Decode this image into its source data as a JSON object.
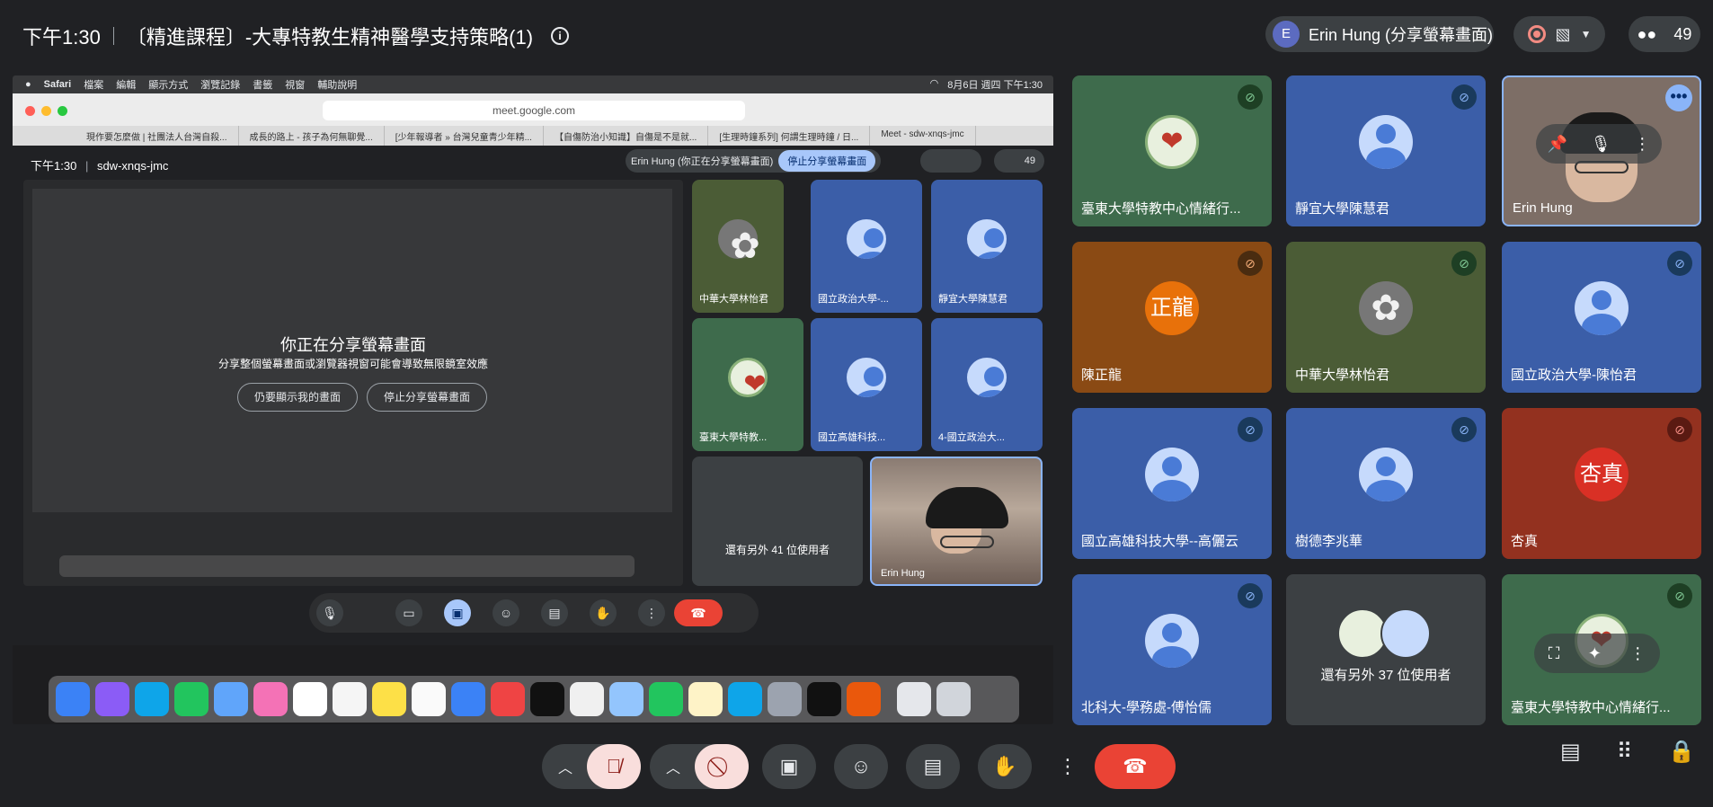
{
  "meeting": {
    "time": "下午1:30",
    "title": "〔精進課程〕-大專特教生精神醫學支持策略(1)",
    "presenter_initial": "E",
    "presenter_label": "Erin Hung (分享螢幕畫面)",
    "participant_count": "49"
  },
  "shared_screen": {
    "mac_menu": [
      "Safari",
      "檔案",
      "編輯",
      "顯示方式",
      "瀏覽記錄",
      "書籤",
      "視窗",
      "輔助說明"
    ],
    "mac_clock": "8月6日 週四 下午1:30",
    "url": "meet.google.com",
    "tabs": [
      "現作要怎麼做 | 社團法人台灣自殺...",
      "成長的路上 - 孩子為何無聊覺...",
      "[少年報導者 » 台灣兒童青少年精...",
      "【自傷防治小知識】自傷是不是就...",
      "[生理時鐘系列] 何謂生理時鐘 / 日...",
      "Meet - sdw-xnqs-jmc"
    ],
    "inner_time": "下午1:30",
    "inner_code": "sdw-xnqs-jmc",
    "inner_presenter": "Erin Hung (你正在分享螢幕畫面)",
    "inner_stop": "停止分享螢幕畫面",
    "inner_count": "49",
    "overlay_title": "你正在分享螢幕畫面",
    "overlay_sub": "分享整個螢幕畫面或瀏覽器視窗可能會導致無限鏡室效應",
    "overlay_show": "仍要顯示我的畫面",
    "overlay_stop": "停止分享螢幕畫面",
    "inner_tiles": [
      "中華大學林怡君",
      "國立政治大學-...",
      "靜宜大學陳慧君",
      "臺東大學特教...",
      "國立高雄科技...",
      "4-國立政治大..."
    ],
    "inner_more": "還有另外 41 位使用者",
    "inner_self": "Erin Hung"
  },
  "tiles": [
    {
      "name": "臺東大學特教中心情緒行...",
      "type": "logo",
      "bg": "#3e6b4c",
      "mic": "green"
    },
    {
      "name": "靜宜大學陳慧君",
      "type": "generic",
      "bg": "#3b5ea8",
      "mic": "blue"
    },
    {
      "name": "Erin Hung",
      "type": "video",
      "bg": "#7d6e66",
      "mic": "none"
    },
    {
      "name": "陳正龍",
      "type": "initial",
      "initial": "正龍",
      "bg": "#8a4a14",
      "circle": "#e8710a",
      "mic": "brown"
    },
    {
      "name": "中華大學林怡君",
      "type": "flower",
      "bg": "#4b5c36",
      "mic": "green"
    },
    {
      "name": "國立政治大學-陳怡君",
      "type": "generic",
      "bg": "#3b5ea8",
      "mic": "blue"
    },
    {
      "name": "國立高雄科技大學--高儷云",
      "type": "generic",
      "bg": "#3b5ea8",
      "mic": "blue"
    },
    {
      "name": "樹德李兆華",
      "type": "generic",
      "bg": "#3b5ea8",
      "mic": "blue"
    },
    {
      "name": "杏真",
      "type": "initial",
      "initial": "杏真",
      "bg": "#93311f",
      "circle": "#d93025",
      "mic": "red"
    },
    {
      "name": "北科大-學務處-傅怡儒",
      "type": "generic",
      "bg": "#3b5ea8",
      "mic": "blue"
    },
    {
      "name": "還有另外 37 位使用者",
      "type": "more",
      "bg": "#3c4043",
      "mic": "none"
    },
    {
      "name": "臺東大學特教中心情緒行...",
      "type": "logo",
      "bg": "#3e6b4c",
      "mic": "green"
    }
  ]
}
